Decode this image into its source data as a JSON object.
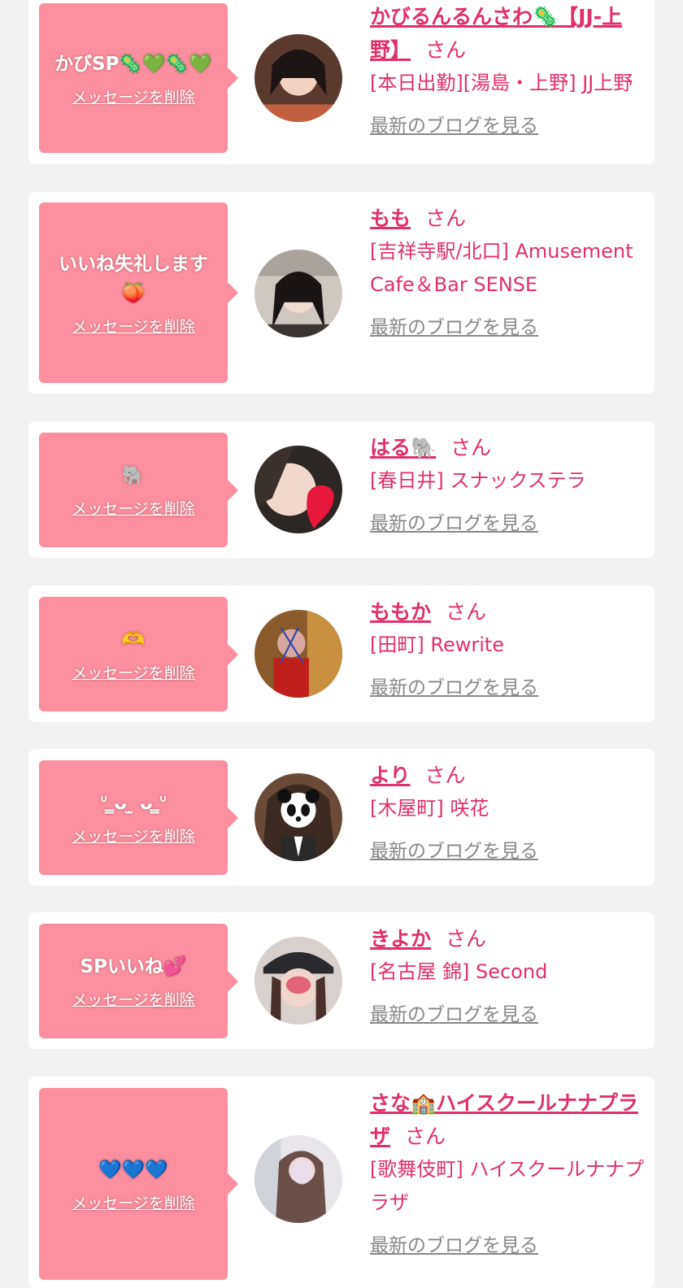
{
  "common": {
    "delete_label": "メッセージを削除",
    "blog_label": "最新のブログを見る",
    "honorific": "さん"
  },
  "colors": {
    "page_bg": "#f2f2f2",
    "bubble": "#fe8fa0",
    "accent": "#e0306c",
    "muted": "#888888"
  },
  "items": [
    {
      "message": "かびSP🦠💚🦠💚",
      "name": "かびるんるんさわ🦠【JJ-上野】",
      "shop": "[本日出勤][湯島・上野] JJ上野"
    },
    {
      "message": "いいね失礼します🍑",
      "name": "もも",
      "shop": "[吉祥寺駅/北口] Amusement Cafe＆Bar SENSE"
    },
    {
      "message": "🐘",
      "name": "はる🐘",
      "shop": "[春日井] スナックステラ"
    },
    {
      "message": "🫶",
      "name": "ももか",
      "shop": "[田町] Rewrite"
    },
    {
      "message": "ᐡ ̳ᴗ ̫ ᴗ ̳ᐡ",
      "name": "より",
      "shop": "[木屋町] 咲花"
    },
    {
      "message": "SPいいね💕",
      "name": "きよか",
      "shop": "[名古屋 錦] Second"
    },
    {
      "message": "💙💙💙",
      "name": "さな🏫ハイスクールナナプラザ",
      "shop": "[歌舞伎町] ハイスクールナナプラザ"
    }
  ]
}
